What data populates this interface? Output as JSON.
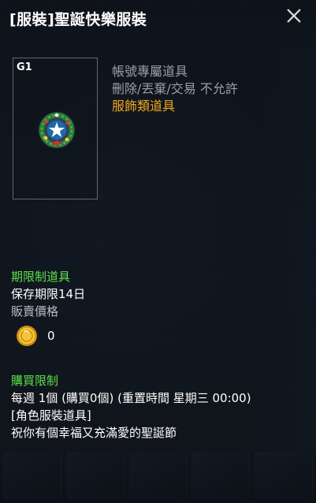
{
  "tooltip": {
    "title": "[服裝]聖誕快樂服裝",
    "item": {
      "grade": "G1",
      "icon": "christmas-wreath-costume-icon"
    },
    "properties": {
      "account_bound": "帳號專屬道具",
      "restrictions": "刪除/丟棄/交易 不允許",
      "category": "服飾類道具"
    },
    "period": {
      "heading": "期限制道具",
      "duration": "保存期限14日"
    },
    "sell": {
      "heading": "販賣價格",
      "currency_icon": "gold-coin-icon",
      "value": "0"
    },
    "purchase": {
      "heading": "購買限制",
      "limit": "每週 1個 (購買0個) (重置時間 星期三 00:00)",
      "type": "[角色服裝道具]",
      "description": "祝你有個幸福又充滿愛的聖誕節"
    }
  },
  "colors": {
    "green": "#5ee04a",
    "orange": "#f0a81e",
    "gray": "#9aa0a6"
  }
}
